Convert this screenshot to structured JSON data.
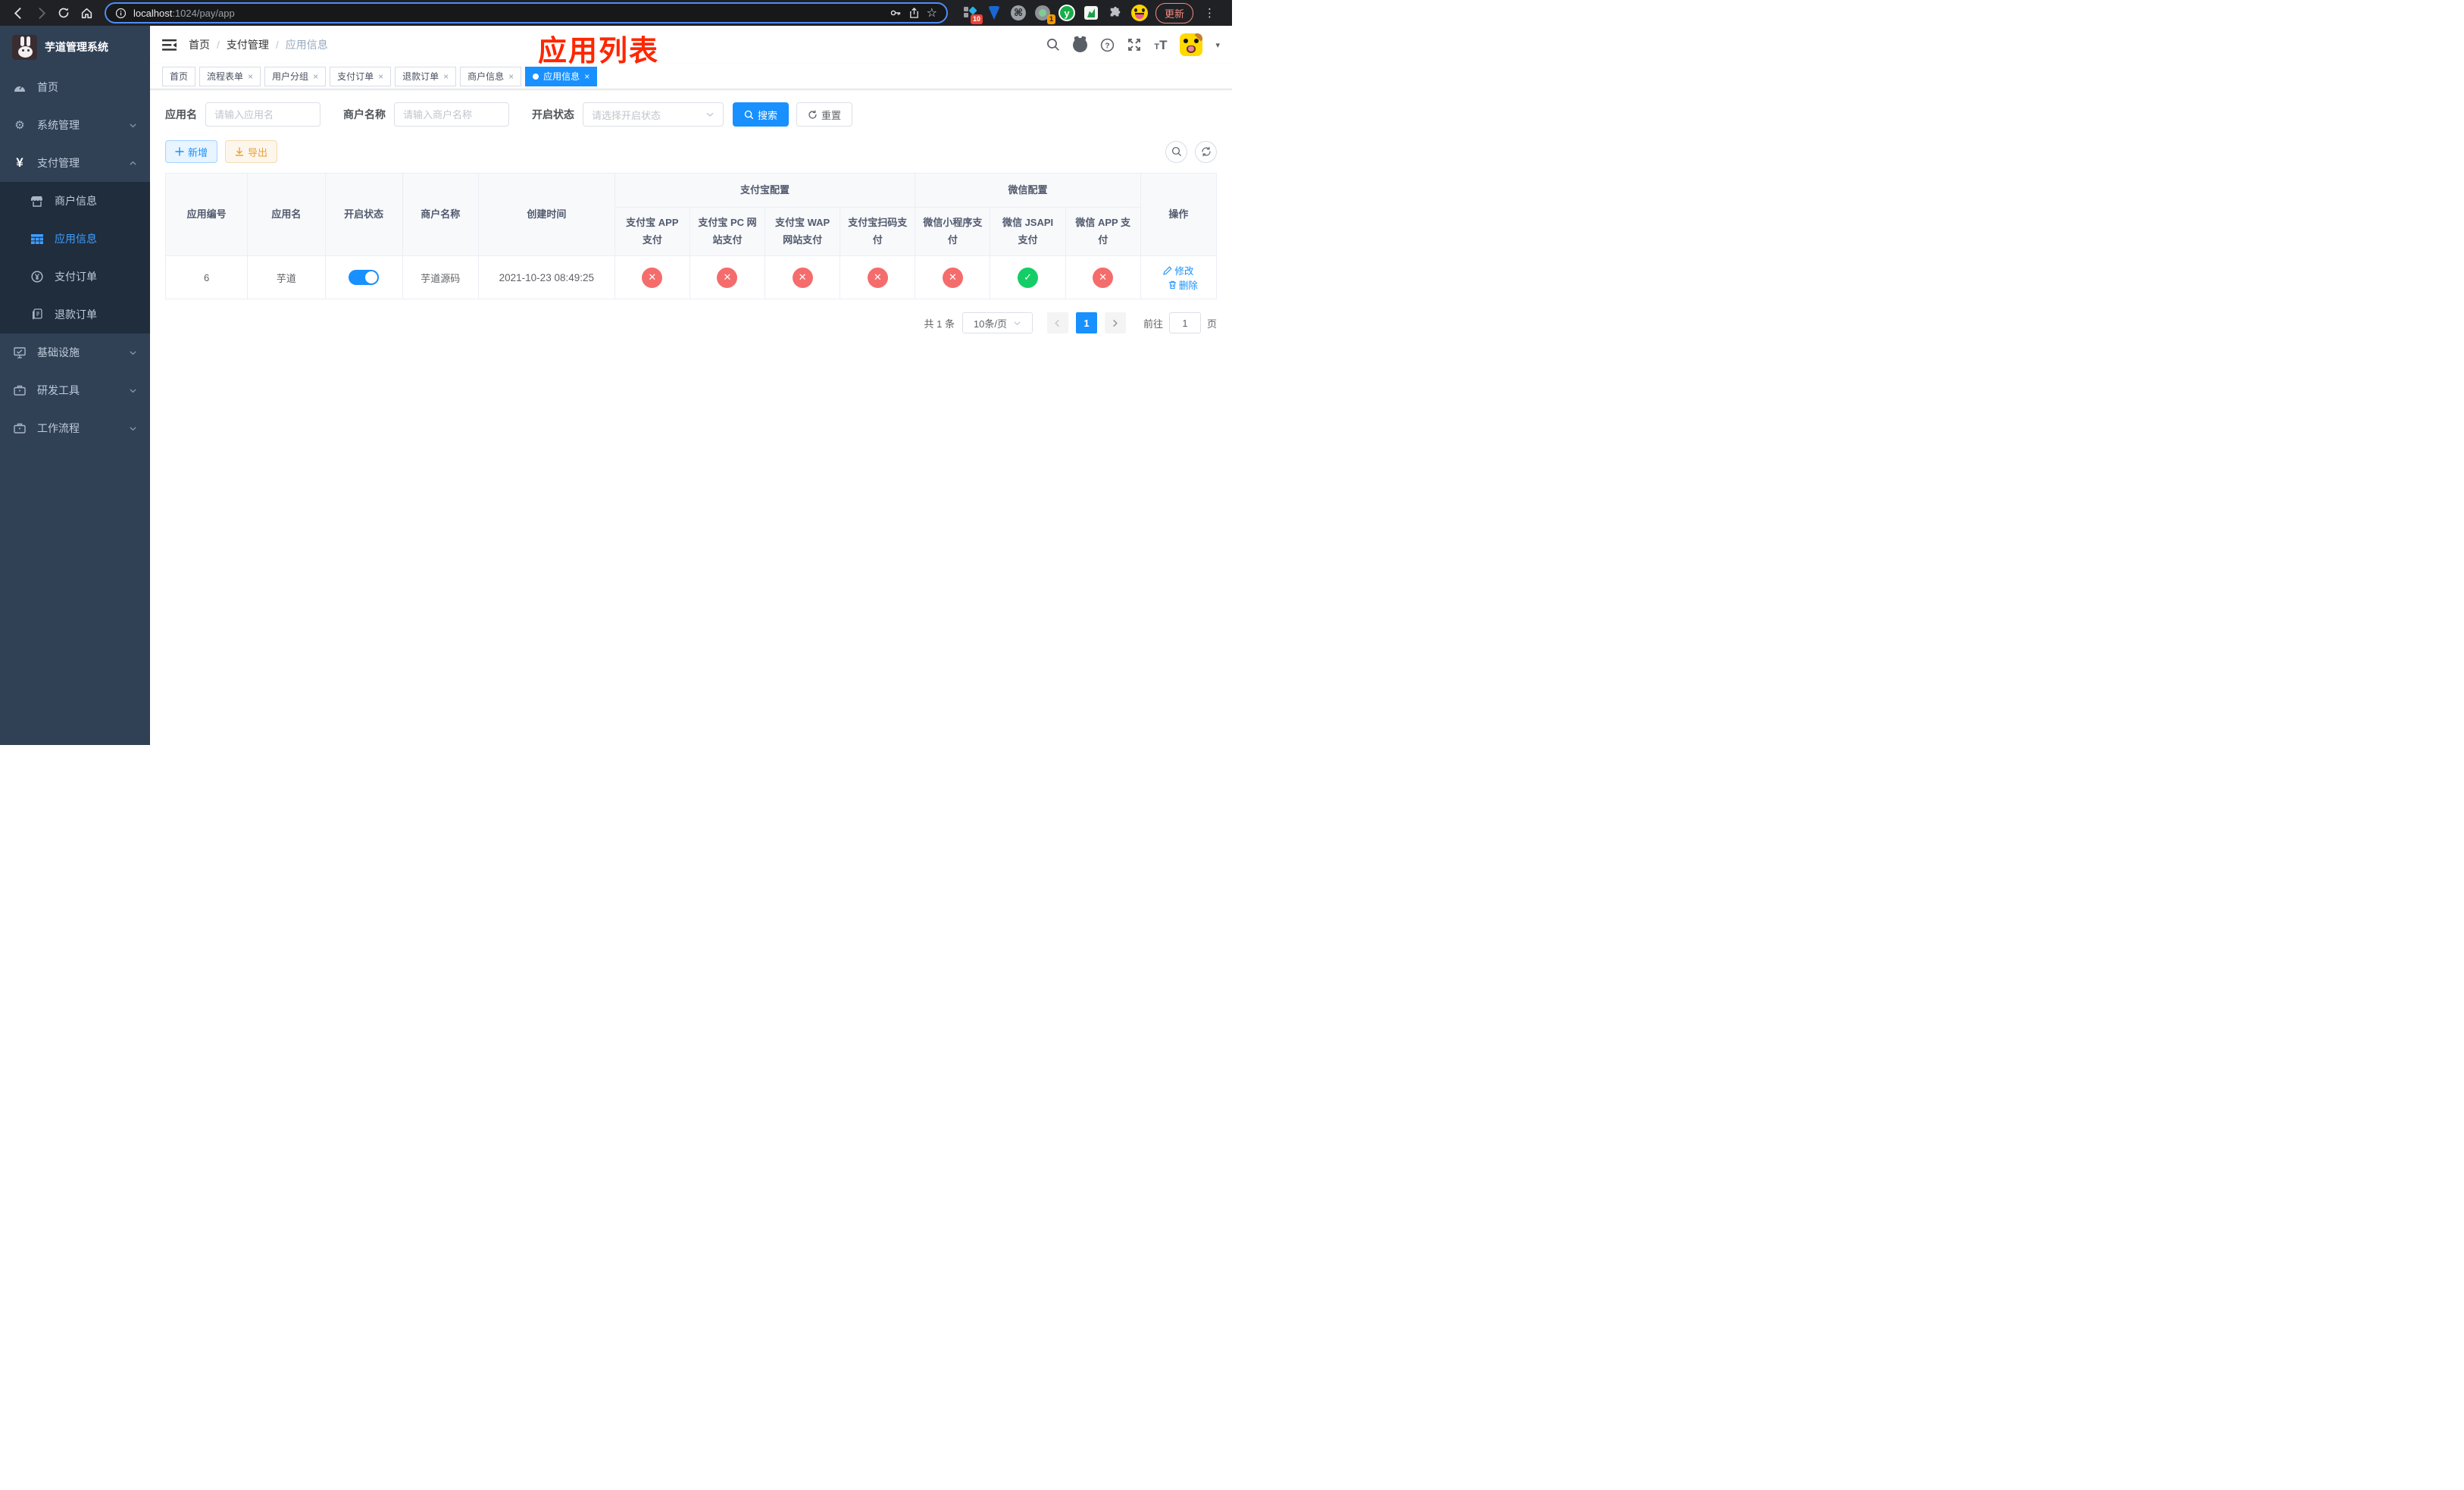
{
  "browser": {
    "url_host": "localhost",
    "url_path": ":1024/pay/app",
    "update_label": "更新",
    "ext_badge_tiles": "10",
    "ext_badge_camera": "1",
    "ext_y_letter": "y",
    "command_glyph": "⌘",
    "star_glyph": "☆",
    "dots_glyph": "⋮"
  },
  "sidebar": {
    "title": "芋道管理系统",
    "items": [
      {
        "label": "首页"
      },
      {
        "label": "系统管理"
      },
      {
        "label": "支付管理"
      },
      {
        "label": "基础设施"
      },
      {
        "label": "研发工具"
      },
      {
        "label": "工作流程"
      }
    ],
    "payment_children": [
      {
        "label": "商户信息"
      },
      {
        "label": "应用信息"
      },
      {
        "label": "支付订单"
      },
      {
        "label": "退款订单"
      }
    ],
    "yen_glyph": "¥",
    "gear_glyph": "⚙"
  },
  "header": {
    "breadcrumb": [
      "首页",
      "支付管理",
      "应用信息"
    ],
    "fontsize_small": "T",
    "fontsize_big": "T",
    "caret_glyph": "▾"
  },
  "annotation": "应用列表",
  "tags": [
    {
      "label": "首页"
    },
    {
      "label": "流程表单"
    },
    {
      "label": "用户分组"
    },
    {
      "label": "支付订单"
    },
    {
      "label": "退款订单"
    },
    {
      "label": "商户信息"
    },
    {
      "label": "应用信息"
    }
  ],
  "filters": {
    "app_name_label": "应用名",
    "app_name_placeholder": "请输入应用名",
    "merchant_label": "商户名称",
    "merchant_placeholder": "请输入商户名称",
    "status_label": "开启状态",
    "status_placeholder": "请选择开启状态",
    "search_label": "搜索",
    "reset_label": "重置"
  },
  "toolbar": {
    "add_label": "新增",
    "export_label": "导出"
  },
  "table": {
    "col_id": "应用编号",
    "col_name": "应用名",
    "col_status": "开启状态",
    "col_merchant": "商户名称",
    "col_created": "创建时间",
    "group_alipay": "支付宝配置",
    "group_wechat": "微信配置",
    "alipay_cols": [
      "支付宝 APP 支付",
      "支付宝 PC 网站支付",
      "支付宝 WAP 网站支付",
      "支付宝扫码支付"
    ],
    "wechat_cols": [
      "微信小程序支付",
      "微信 JSAPI 支付",
      "微信 APP 支付"
    ],
    "col_op": "操作",
    "row": {
      "id": "6",
      "name": "芋道",
      "enabled": true,
      "merchant": "芋道源码",
      "created": "2021-10-23 08:49:25",
      "pay_status": [
        false,
        false,
        false,
        false,
        false,
        true,
        false
      ],
      "edit_label": "修改",
      "delete_label": "删除"
    }
  },
  "pagination": {
    "total": "共 1 条",
    "page_size": "10条/页",
    "current": "1",
    "goto_label": "前往",
    "goto_value": "1",
    "unit": "页"
  }
}
